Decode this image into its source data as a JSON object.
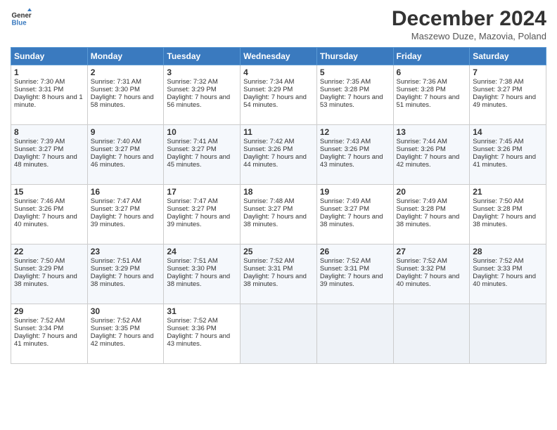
{
  "header": {
    "logo_line1": "General",
    "logo_line2": "Blue",
    "month": "December 2024",
    "location": "Maszewo Duze, Mazovia, Poland"
  },
  "days_of_week": [
    "Sunday",
    "Monday",
    "Tuesday",
    "Wednesday",
    "Thursday",
    "Friday",
    "Saturday"
  ],
  "weeks": [
    [
      {
        "num": "1",
        "sunrise": "Sunrise: 7:30 AM",
        "sunset": "Sunset: 3:31 PM",
        "daylight": "Daylight: 8 hours and 1 minute."
      },
      {
        "num": "2",
        "sunrise": "Sunrise: 7:31 AM",
        "sunset": "Sunset: 3:30 PM",
        "daylight": "Daylight: 7 hours and 58 minutes."
      },
      {
        "num": "3",
        "sunrise": "Sunrise: 7:32 AM",
        "sunset": "Sunset: 3:29 PM",
        "daylight": "Daylight: 7 hours and 56 minutes."
      },
      {
        "num": "4",
        "sunrise": "Sunrise: 7:34 AM",
        "sunset": "Sunset: 3:29 PM",
        "daylight": "Daylight: 7 hours and 54 minutes."
      },
      {
        "num": "5",
        "sunrise": "Sunrise: 7:35 AM",
        "sunset": "Sunset: 3:28 PM",
        "daylight": "Daylight: 7 hours and 53 minutes."
      },
      {
        "num": "6",
        "sunrise": "Sunrise: 7:36 AM",
        "sunset": "Sunset: 3:28 PM",
        "daylight": "Daylight: 7 hours and 51 minutes."
      },
      {
        "num": "7",
        "sunrise": "Sunrise: 7:38 AM",
        "sunset": "Sunset: 3:27 PM",
        "daylight": "Daylight: 7 hours and 49 minutes."
      }
    ],
    [
      {
        "num": "8",
        "sunrise": "Sunrise: 7:39 AM",
        "sunset": "Sunset: 3:27 PM",
        "daylight": "Daylight: 7 hours and 48 minutes."
      },
      {
        "num": "9",
        "sunrise": "Sunrise: 7:40 AM",
        "sunset": "Sunset: 3:27 PM",
        "daylight": "Daylight: 7 hours and 46 minutes."
      },
      {
        "num": "10",
        "sunrise": "Sunrise: 7:41 AM",
        "sunset": "Sunset: 3:27 PM",
        "daylight": "Daylight: 7 hours and 45 minutes."
      },
      {
        "num": "11",
        "sunrise": "Sunrise: 7:42 AM",
        "sunset": "Sunset: 3:26 PM",
        "daylight": "Daylight: 7 hours and 44 minutes."
      },
      {
        "num": "12",
        "sunrise": "Sunrise: 7:43 AM",
        "sunset": "Sunset: 3:26 PM",
        "daylight": "Daylight: 7 hours and 43 minutes."
      },
      {
        "num": "13",
        "sunrise": "Sunrise: 7:44 AM",
        "sunset": "Sunset: 3:26 PM",
        "daylight": "Daylight: 7 hours and 42 minutes."
      },
      {
        "num": "14",
        "sunrise": "Sunrise: 7:45 AM",
        "sunset": "Sunset: 3:26 PM",
        "daylight": "Daylight: 7 hours and 41 minutes."
      }
    ],
    [
      {
        "num": "15",
        "sunrise": "Sunrise: 7:46 AM",
        "sunset": "Sunset: 3:26 PM",
        "daylight": "Daylight: 7 hours and 40 minutes."
      },
      {
        "num": "16",
        "sunrise": "Sunrise: 7:47 AM",
        "sunset": "Sunset: 3:27 PM",
        "daylight": "Daylight: 7 hours and 39 minutes."
      },
      {
        "num": "17",
        "sunrise": "Sunrise: 7:47 AM",
        "sunset": "Sunset: 3:27 PM",
        "daylight": "Daylight: 7 hours and 39 minutes."
      },
      {
        "num": "18",
        "sunrise": "Sunrise: 7:48 AM",
        "sunset": "Sunset: 3:27 PM",
        "daylight": "Daylight: 7 hours and 38 minutes."
      },
      {
        "num": "19",
        "sunrise": "Sunrise: 7:49 AM",
        "sunset": "Sunset: 3:27 PM",
        "daylight": "Daylight: 7 hours and 38 minutes."
      },
      {
        "num": "20",
        "sunrise": "Sunrise: 7:49 AM",
        "sunset": "Sunset: 3:28 PM",
        "daylight": "Daylight: 7 hours and 38 minutes."
      },
      {
        "num": "21",
        "sunrise": "Sunrise: 7:50 AM",
        "sunset": "Sunset: 3:28 PM",
        "daylight": "Daylight: 7 hours and 38 minutes."
      }
    ],
    [
      {
        "num": "22",
        "sunrise": "Sunrise: 7:50 AM",
        "sunset": "Sunset: 3:29 PM",
        "daylight": "Daylight: 7 hours and 38 minutes."
      },
      {
        "num": "23",
        "sunrise": "Sunrise: 7:51 AM",
        "sunset": "Sunset: 3:29 PM",
        "daylight": "Daylight: 7 hours and 38 minutes."
      },
      {
        "num": "24",
        "sunrise": "Sunrise: 7:51 AM",
        "sunset": "Sunset: 3:30 PM",
        "daylight": "Daylight: 7 hours and 38 minutes."
      },
      {
        "num": "25",
        "sunrise": "Sunrise: 7:52 AM",
        "sunset": "Sunset: 3:31 PM",
        "daylight": "Daylight: 7 hours and 38 minutes."
      },
      {
        "num": "26",
        "sunrise": "Sunrise: 7:52 AM",
        "sunset": "Sunset: 3:31 PM",
        "daylight": "Daylight: 7 hours and 39 minutes."
      },
      {
        "num": "27",
        "sunrise": "Sunrise: 7:52 AM",
        "sunset": "Sunset: 3:32 PM",
        "daylight": "Daylight: 7 hours and 40 minutes."
      },
      {
        "num": "28",
        "sunrise": "Sunrise: 7:52 AM",
        "sunset": "Sunset: 3:33 PM",
        "daylight": "Daylight: 7 hours and 40 minutes."
      }
    ],
    [
      {
        "num": "29",
        "sunrise": "Sunrise: 7:52 AM",
        "sunset": "Sunset: 3:34 PM",
        "daylight": "Daylight: 7 hours and 41 minutes."
      },
      {
        "num": "30",
        "sunrise": "Sunrise: 7:52 AM",
        "sunset": "Sunset: 3:35 PM",
        "daylight": "Daylight: 7 hours and 42 minutes."
      },
      {
        "num": "31",
        "sunrise": "Sunrise: 7:52 AM",
        "sunset": "Sunset: 3:36 PM",
        "daylight": "Daylight: 7 hours and 43 minutes."
      },
      null,
      null,
      null,
      null
    ]
  ]
}
